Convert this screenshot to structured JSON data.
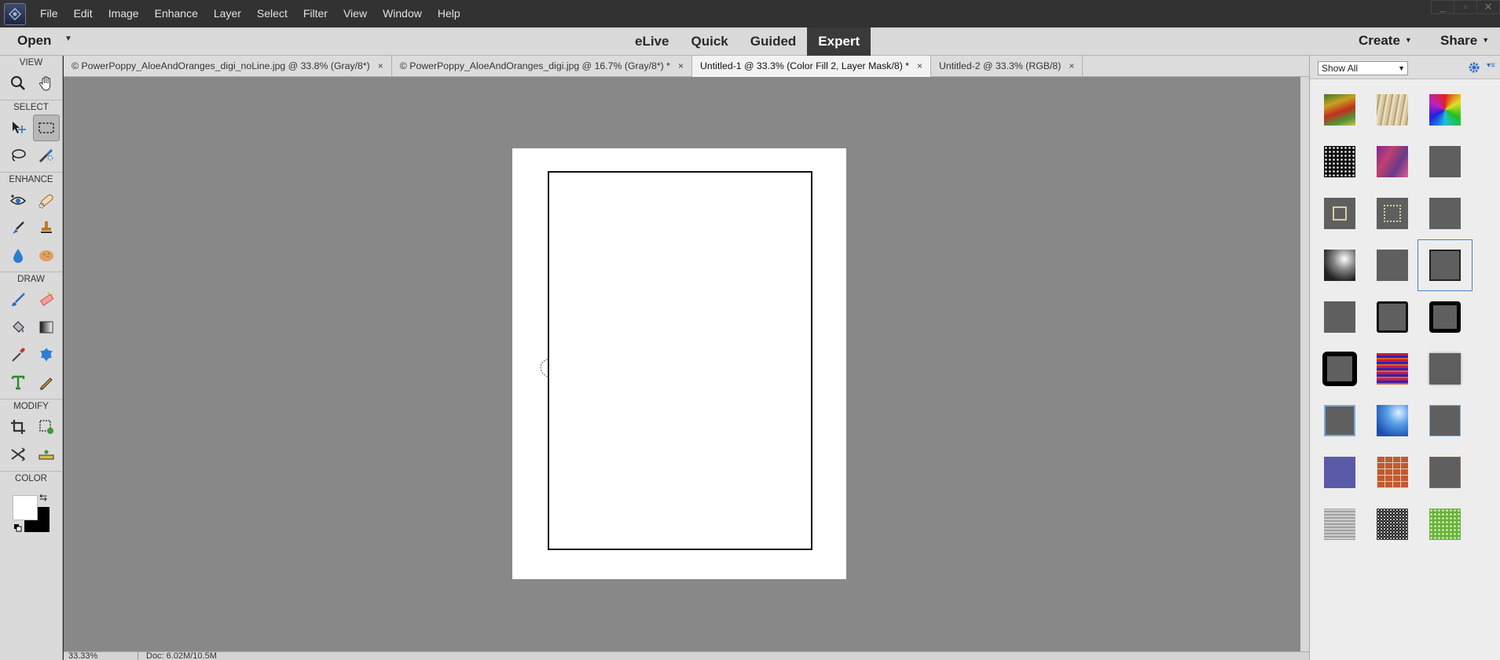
{
  "menu": [
    "File",
    "Edit",
    "Image",
    "Enhance",
    "Layer",
    "Select",
    "Filter",
    "View",
    "Window",
    "Help"
  ],
  "window_controls": [
    "_",
    "▫",
    "✕"
  ],
  "modebar": {
    "open_label": "Open",
    "modes": [
      "eLive",
      "Quick",
      "Guided",
      "Expert"
    ],
    "active_mode": "Expert",
    "create_label": "Create",
    "share_label": "Share"
  },
  "toolbox": {
    "sections": {
      "view": "VIEW",
      "select": "SELECT",
      "enhance": "ENHANCE",
      "draw": "DRAW",
      "modify": "MODIFY",
      "color": "COLOR"
    },
    "tools": [
      "zoom-tool",
      "hand-tool",
      "move-tool",
      "rectangular-marquee-tool",
      "lasso-tool",
      "quick-selection-tool",
      "red-eye-tool",
      "spot-healing-tool",
      "smart-brush-tool",
      "clone-stamp-tool",
      "blur-tool",
      "sponge-tool",
      "brush-tool",
      "eraser-tool",
      "paint-bucket-tool",
      "gradient-tool",
      "eyedropper-tool",
      "custom-shape-tool",
      "type-tool",
      "pencil-tool",
      "crop-tool",
      "recompose-tool",
      "content-aware-move-tool",
      "straighten-tool"
    ],
    "active_tool": "rectangular-marquee-tool",
    "foreground_color": "#ffffff",
    "background_color": "#000000"
  },
  "doc_tabs": [
    {
      "label": "© PowerPoppy_AloeAndOranges_digi_noLine.jpg @ 33.8% (Gray/8*)",
      "active": false
    },
    {
      "label": "© PowerPoppy_AloeAndOranges_digi.jpg @ 16.7% (Gray/8*) *",
      "active": false
    },
    {
      "label": "Untitled-1 @ 33.3% (Color Fill 2, Layer Mask/8) *",
      "active": true
    },
    {
      "label": "Untitled-2 @ 33.3% (RGB/8)",
      "active": false
    }
  ],
  "tab_close": "×",
  "status": {
    "zoom": "33.33%",
    "doc_size": "Doc: 6.02M/10.5M"
  },
  "panel": {
    "filter_select": "Show All",
    "swatches": [
      "rainbow-smear",
      "gold-texture",
      "rainbow-burst",
      "black-speckle",
      "purple-marble",
      "plain-gray",
      "gray-outline-square",
      "gray-dotted-square",
      "plain-gray",
      "soft-glow",
      "plain-gray",
      "gray-inner-border",
      "plain-gray",
      "black-thin-border",
      "black-thick-border",
      "black-round-thick-border",
      "rainbow-stripes",
      "gray-soft-border",
      "blue-gray-border",
      "blue-shine",
      "blue-outline",
      "purple-blue",
      "brick-texture",
      "brown-border",
      "brushed-metal",
      "dark-granite",
      "green-dots"
    ],
    "selected_swatch_index": 11
  }
}
